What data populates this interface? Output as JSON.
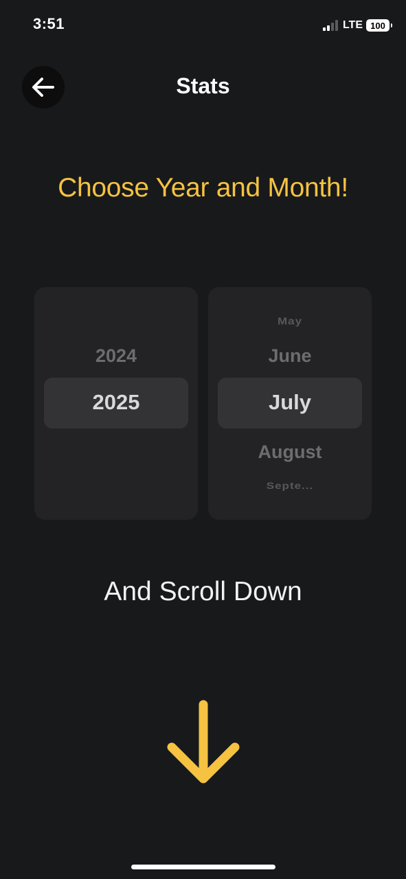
{
  "status_bar": {
    "time": "3:51",
    "network": "LTE",
    "battery": "100"
  },
  "header": {
    "title": "Stats",
    "back_icon": "arrow-left-icon"
  },
  "prompt": "Choose Year and Month!",
  "year_picker": {
    "above": "2024",
    "selected": "2025"
  },
  "month_picker": {
    "far_above": "May",
    "above": "June",
    "selected": "July",
    "below": "August",
    "far_below": "Septe..."
  },
  "hint": "And Scroll Down",
  "scroll_icon": "arrow-down-icon",
  "colors": {
    "background": "#18191b",
    "accent": "#f5c242",
    "picker_bg": "#232325"
  }
}
